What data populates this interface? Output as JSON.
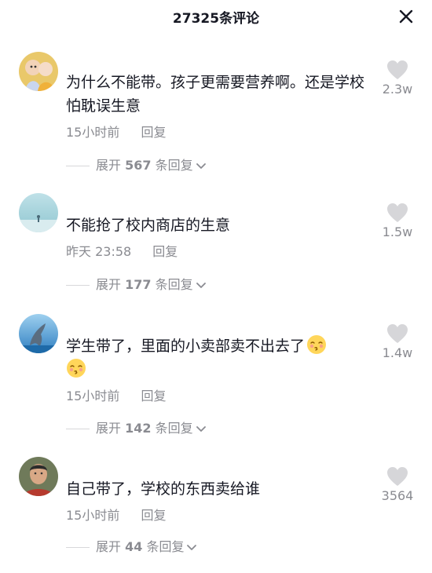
{
  "header": {
    "title": "27325条评论",
    "close_icon": "close-icon"
  },
  "comments": [
    {
      "text": "为什么不能带。孩子更需要营养啊。还是学校怕耽误生意",
      "time": "15小时前",
      "reply_label": "回复",
      "expand_prefix": "展开",
      "expand_count": "567",
      "expand_suffix": "条回复",
      "likes": "2.3w"
    },
    {
      "text": "不能抢了校内商店的生意",
      "time": "昨天 23:58",
      "reply_label": "回复",
      "expand_prefix": "展开",
      "expand_count": "177",
      "expand_suffix": "条回复",
      "likes": "1.5w"
    },
    {
      "text": "学生带了，里面的小卖部卖不出去了",
      "emoji": "kissing-face-emoji",
      "time": "15小时前",
      "reply_label": "回复",
      "expand_prefix": "展开",
      "expand_count": "142",
      "expand_suffix": "条回复",
      "likes": "1.4w"
    },
    {
      "text": "自己带了，学校的东西卖给谁",
      "time": "15小时前",
      "reply_label": "回复",
      "expand_prefix": "展开",
      "expand_count": "44",
      "expand_suffix": "条回复",
      "likes": "3564"
    }
  ],
  "icons": {
    "like": "heart-icon",
    "expand": "chevron-down-icon"
  },
  "colors": {
    "text": "#161823",
    "secondary": "#8a8b91",
    "heart": "#d6d6d9"
  }
}
